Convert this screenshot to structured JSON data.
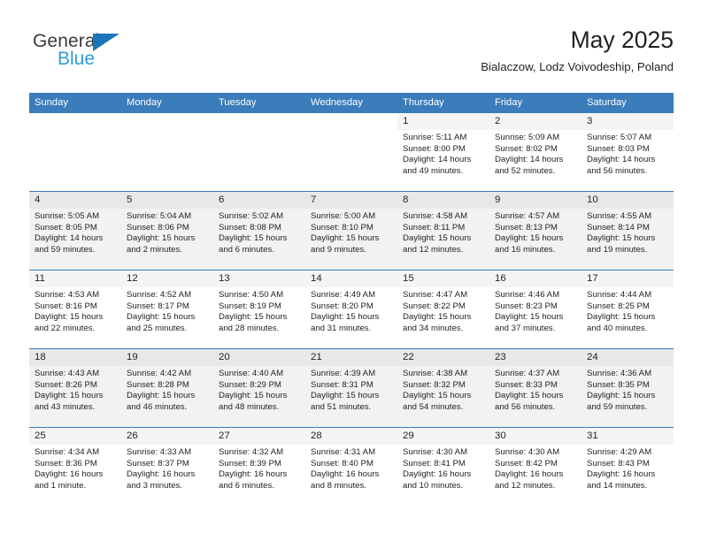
{
  "brand": {
    "name_part1": "General",
    "name_part2": "Blue",
    "triangle_color": "#1b75bb",
    "blue_text_color": "#2e9bd6"
  },
  "header": {
    "title": "May 2025",
    "subtitle": "Bialaczow, Lodz Voivodeship, Poland"
  },
  "theme": {
    "header_bar_color": "#3b7cba",
    "row_shaded_color": "#f2f2f2",
    "daynum_strip_color": "#f4f4f4",
    "text_color": "#231f20"
  },
  "weekdays": [
    "Sunday",
    "Monday",
    "Tuesday",
    "Wednesday",
    "Thursday",
    "Friday",
    "Saturday"
  ],
  "weeks": [
    {
      "shaded": false,
      "days": [
        {
          "num": "",
          "empty": true,
          "lines": []
        },
        {
          "num": "",
          "empty": true,
          "lines": []
        },
        {
          "num": "",
          "empty": true,
          "lines": []
        },
        {
          "num": "",
          "empty": true,
          "lines": []
        },
        {
          "num": "1",
          "empty": false,
          "lines": [
            "Sunrise: 5:11 AM",
            "Sunset: 8:00 PM",
            "Daylight: 14 hours",
            "and 49 minutes."
          ]
        },
        {
          "num": "2",
          "empty": false,
          "lines": [
            "Sunrise: 5:09 AM",
            "Sunset: 8:02 PM",
            "Daylight: 14 hours",
            "and 52 minutes."
          ]
        },
        {
          "num": "3",
          "empty": false,
          "lines": [
            "Sunrise: 5:07 AM",
            "Sunset: 8:03 PM",
            "Daylight: 14 hours",
            "and 56 minutes."
          ]
        }
      ]
    },
    {
      "shaded": true,
      "days": [
        {
          "num": "4",
          "empty": false,
          "lines": [
            "Sunrise: 5:05 AM",
            "Sunset: 8:05 PM",
            "Daylight: 14 hours",
            "and 59 minutes."
          ]
        },
        {
          "num": "5",
          "empty": false,
          "lines": [
            "Sunrise: 5:04 AM",
            "Sunset: 8:06 PM",
            "Daylight: 15 hours",
            "and 2 minutes."
          ]
        },
        {
          "num": "6",
          "empty": false,
          "lines": [
            "Sunrise: 5:02 AM",
            "Sunset: 8:08 PM",
            "Daylight: 15 hours",
            "and 6 minutes."
          ]
        },
        {
          "num": "7",
          "empty": false,
          "lines": [
            "Sunrise: 5:00 AM",
            "Sunset: 8:10 PM",
            "Daylight: 15 hours",
            "and 9 minutes."
          ]
        },
        {
          "num": "8",
          "empty": false,
          "lines": [
            "Sunrise: 4:58 AM",
            "Sunset: 8:11 PM",
            "Daylight: 15 hours",
            "and 12 minutes."
          ]
        },
        {
          "num": "9",
          "empty": false,
          "lines": [
            "Sunrise: 4:57 AM",
            "Sunset: 8:13 PM",
            "Daylight: 15 hours",
            "and 16 minutes."
          ]
        },
        {
          "num": "10",
          "empty": false,
          "lines": [
            "Sunrise: 4:55 AM",
            "Sunset: 8:14 PM",
            "Daylight: 15 hours",
            "and 19 minutes."
          ]
        }
      ]
    },
    {
      "shaded": false,
      "days": [
        {
          "num": "11",
          "empty": false,
          "lines": [
            "Sunrise: 4:53 AM",
            "Sunset: 8:16 PM",
            "Daylight: 15 hours",
            "and 22 minutes."
          ]
        },
        {
          "num": "12",
          "empty": false,
          "lines": [
            "Sunrise: 4:52 AM",
            "Sunset: 8:17 PM",
            "Daylight: 15 hours",
            "and 25 minutes."
          ]
        },
        {
          "num": "13",
          "empty": false,
          "lines": [
            "Sunrise: 4:50 AM",
            "Sunset: 8:19 PM",
            "Daylight: 15 hours",
            "and 28 minutes."
          ]
        },
        {
          "num": "14",
          "empty": false,
          "lines": [
            "Sunrise: 4:49 AM",
            "Sunset: 8:20 PM",
            "Daylight: 15 hours",
            "and 31 minutes."
          ]
        },
        {
          "num": "15",
          "empty": false,
          "lines": [
            "Sunrise: 4:47 AM",
            "Sunset: 8:22 PM",
            "Daylight: 15 hours",
            "and 34 minutes."
          ]
        },
        {
          "num": "16",
          "empty": false,
          "lines": [
            "Sunrise: 4:46 AM",
            "Sunset: 8:23 PM",
            "Daylight: 15 hours",
            "and 37 minutes."
          ]
        },
        {
          "num": "17",
          "empty": false,
          "lines": [
            "Sunrise: 4:44 AM",
            "Sunset: 8:25 PM",
            "Daylight: 15 hours",
            "and 40 minutes."
          ]
        }
      ]
    },
    {
      "shaded": true,
      "days": [
        {
          "num": "18",
          "empty": false,
          "lines": [
            "Sunrise: 4:43 AM",
            "Sunset: 8:26 PM",
            "Daylight: 15 hours",
            "and 43 minutes."
          ]
        },
        {
          "num": "19",
          "empty": false,
          "lines": [
            "Sunrise: 4:42 AM",
            "Sunset: 8:28 PM",
            "Daylight: 15 hours",
            "and 46 minutes."
          ]
        },
        {
          "num": "20",
          "empty": false,
          "lines": [
            "Sunrise: 4:40 AM",
            "Sunset: 8:29 PM",
            "Daylight: 15 hours",
            "and 48 minutes."
          ]
        },
        {
          "num": "21",
          "empty": false,
          "lines": [
            "Sunrise: 4:39 AM",
            "Sunset: 8:31 PM",
            "Daylight: 15 hours",
            "and 51 minutes."
          ]
        },
        {
          "num": "22",
          "empty": false,
          "lines": [
            "Sunrise: 4:38 AM",
            "Sunset: 8:32 PM",
            "Daylight: 15 hours",
            "and 54 minutes."
          ]
        },
        {
          "num": "23",
          "empty": false,
          "lines": [
            "Sunrise: 4:37 AM",
            "Sunset: 8:33 PM",
            "Daylight: 15 hours",
            "and 56 minutes."
          ]
        },
        {
          "num": "24",
          "empty": false,
          "lines": [
            "Sunrise: 4:36 AM",
            "Sunset: 8:35 PM",
            "Daylight: 15 hours",
            "and 59 minutes."
          ]
        }
      ]
    },
    {
      "shaded": false,
      "days": [
        {
          "num": "25",
          "empty": false,
          "lines": [
            "Sunrise: 4:34 AM",
            "Sunset: 8:36 PM",
            "Daylight: 16 hours",
            "and 1 minute."
          ]
        },
        {
          "num": "26",
          "empty": false,
          "lines": [
            "Sunrise: 4:33 AM",
            "Sunset: 8:37 PM",
            "Daylight: 16 hours",
            "and 3 minutes."
          ]
        },
        {
          "num": "27",
          "empty": false,
          "lines": [
            "Sunrise: 4:32 AM",
            "Sunset: 8:39 PM",
            "Daylight: 16 hours",
            "and 6 minutes."
          ]
        },
        {
          "num": "28",
          "empty": false,
          "lines": [
            "Sunrise: 4:31 AM",
            "Sunset: 8:40 PM",
            "Daylight: 16 hours",
            "and 8 minutes."
          ]
        },
        {
          "num": "29",
          "empty": false,
          "lines": [
            "Sunrise: 4:30 AM",
            "Sunset: 8:41 PM",
            "Daylight: 16 hours",
            "and 10 minutes."
          ]
        },
        {
          "num": "30",
          "empty": false,
          "lines": [
            "Sunrise: 4:30 AM",
            "Sunset: 8:42 PM",
            "Daylight: 16 hours",
            "and 12 minutes."
          ]
        },
        {
          "num": "31",
          "empty": false,
          "lines": [
            "Sunrise: 4:29 AM",
            "Sunset: 8:43 PM",
            "Daylight: 16 hours",
            "and 14 minutes."
          ]
        }
      ]
    }
  ]
}
